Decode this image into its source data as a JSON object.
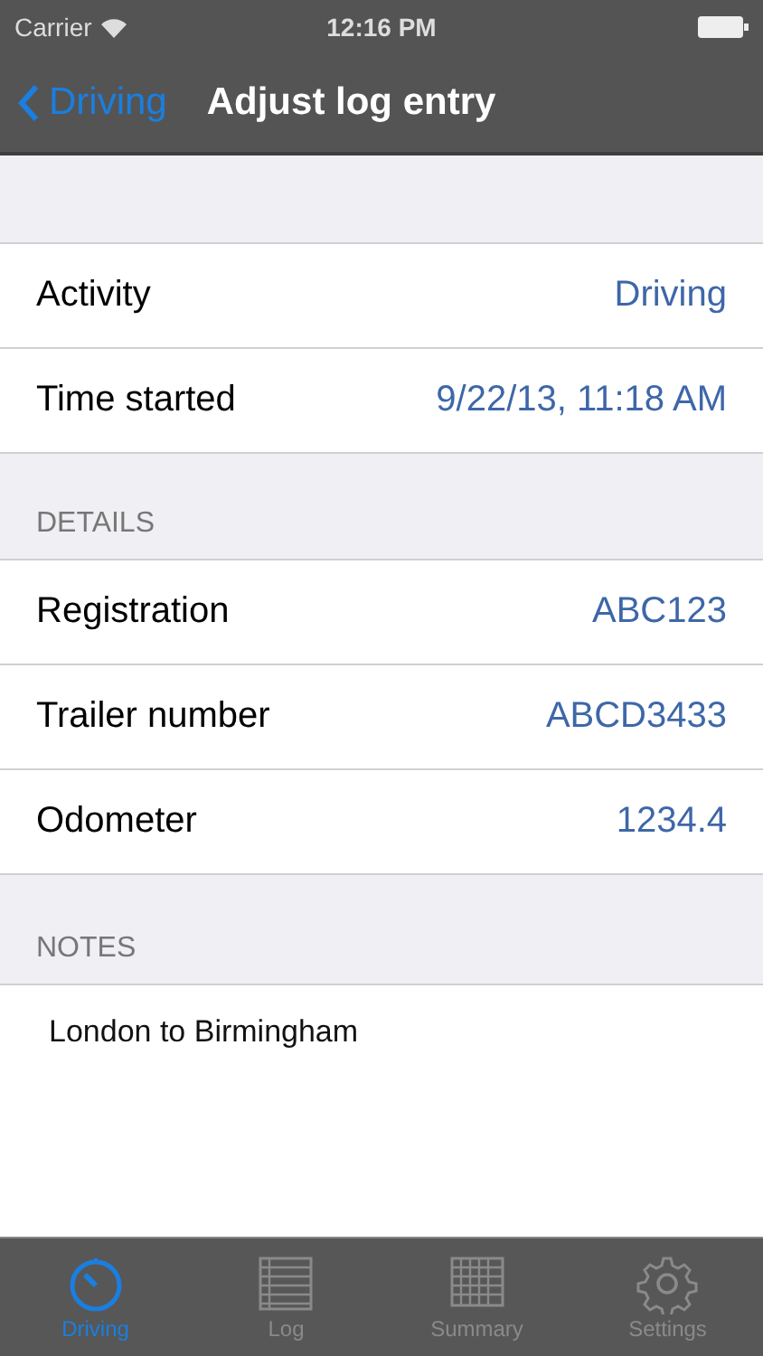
{
  "status_bar": {
    "carrier": "Carrier",
    "time": "12:16 PM"
  },
  "nav_bar": {
    "back": "Driving",
    "title": "Adjust log entry"
  },
  "sections": [
    {
      "rows": [
        {
          "label": "Activity",
          "value": "Driving"
        },
        {
          "label": "Time started",
          "value": "9/22/13, 11:18 AM"
        }
      ]
    },
    {
      "header": "DETAILS",
      "rows": [
        {
          "label": "Registration",
          "value": "ABC123"
        },
        {
          "label": "Trailer number",
          "value": "ABCD3433"
        },
        {
          "label": "Odometer",
          "value": "1234.4"
        }
      ]
    }
  ],
  "notes": {
    "header": "NOTES",
    "text": "London to Birmingham"
  },
  "tab_bar": [
    {
      "label": "Driving",
      "kind": "timer",
      "selected": true
    },
    {
      "label": "Log",
      "kind": "list",
      "selected": false
    },
    {
      "label": "Summary",
      "kind": "grid",
      "selected": false
    },
    {
      "label": "Settings",
      "kind": "gear",
      "selected": false
    }
  ]
}
